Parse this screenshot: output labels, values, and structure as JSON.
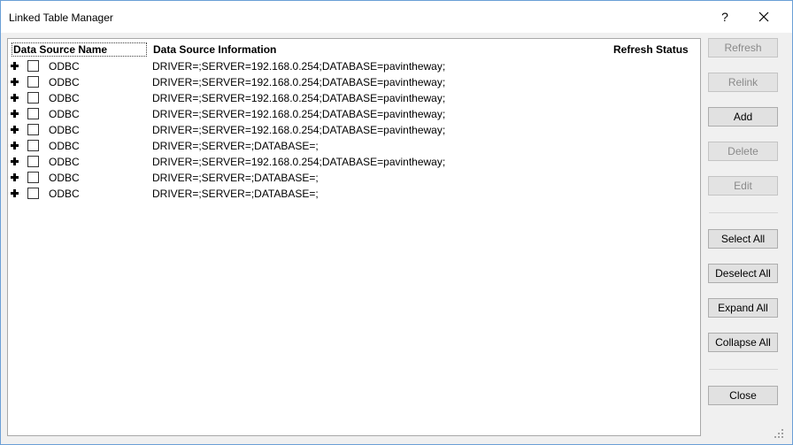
{
  "window": {
    "title": "Linked Table Manager",
    "help_label": "?"
  },
  "columns": {
    "name": "Data Source Name",
    "info": "Data Source Information",
    "status": "Refresh Status"
  },
  "rows": [
    {
      "name": "ODBC",
      "info": "DRIVER=;SERVER=192.168.0.254;DATABASE=pavintheway;"
    },
    {
      "name": "ODBC",
      "info": "DRIVER=;SERVER=192.168.0.254;DATABASE=pavintheway;"
    },
    {
      "name": "ODBC",
      "info": "DRIVER=;SERVER=192.168.0.254;DATABASE=pavintheway;"
    },
    {
      "name": "ODBC",
      "info": "DRIVER=;SERVER=192.168.0.254;DATABASE=pavintheway;"
    },
    {
      "name": "ODBC",
      "info": "DRIVER=;SERVER=192.168.0.254;DATABASE=pavintheway;"
    },
    {
      "name": "ODBC",
      "info": "DRIVER=;SERVER=;DATABASE=;"
    },
    {
      "name": "ODBC",
      "info": "DRIVER=;SERVER=192.168.0.254;DATABASE=pavintheway;"
    },
    {
      "name": "ODBC",
      "info": "DRIVER=;SERVER=;DATABASE=;"
    },
    {
      "name": "ODBC",
      "info": "DRIVER=;SERVER=;DATABASE=;"
    }
  ],
  "buttons": {
    "refresh": "Refresh",
    "relink": "Relink",
    "add": "Add",
    "delete": "Delete",
    "edit": "Edit",
    "select_all": "Select All",
    "deselect_all": "Deselect All",
    "expand_all": "Expand All",
    "collapse_all": "Collapse All",
    "close": "Close"
  }
}
